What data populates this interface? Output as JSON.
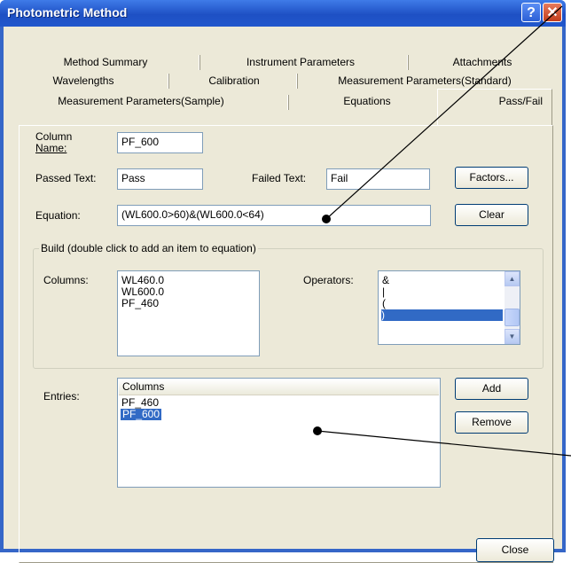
{
  "window": {
    "title": "Photometric Method",
    "help_glyph": "?",
    "close_glyph": "✕"
  },
  "tabs": {
    "row1": [
      "Method Summary",
      "Instrument Parameters",
      "Attachments"
    ],
    "row2": [
      "Wavelengths",
      "Calibration",
      "Measurement Parameters(Standard)"
    ],
    "row3": [
      "Measurement Parameters(Sample)",
      "Equations",
      "Pass/Fail"
    ],
    "active": "Pass/Fail"
  },
  "form": {
    "column_name_label_1": "Column",
    "column_name_label_2": "Name:",
    "column_name_value": "PF_600",
    "passed_text_label": "Passed Text:",
    "passed_text_value": "Pass",
    "failed_text_label": "Failed Text:",
    "failed_text_value": "Fail",
    "factors_button": "Factors...",
    "equation_label": "Equation:",
    "equation_value": "(WL600.0>60)&(WL600.0<64)",
    "clear_button": "Clear"
  },
  "build": {
    "legend": "Build  (double click to add an item to equation)",
    "columns_label": "Columns:",
    "columns": [
      "WL460.0",
      "WL600.0",
      "PF_460"
    ],
    "operators_label": "Operators:",
    "operators": [
      "&",
      "|",
      "(",
      ")"
    ],
    "selected_operator": ")"
  },
  "entries": {
    "label": "Entries:",
    "header": "Columns",
    "items": [
      "PF_460",
      "PF_600"
    ],
    "selected": "PF_600",
    "add_button": "Add",
    "remove_button": "Remove"
  },
  "footer": {
    "close_button": "Close"
  },
  "colors": {
    "titlebar": "#2157cc",
    "selection": "#316ac5",
    "dialog_bg": "#ece9d8"
  }
}
